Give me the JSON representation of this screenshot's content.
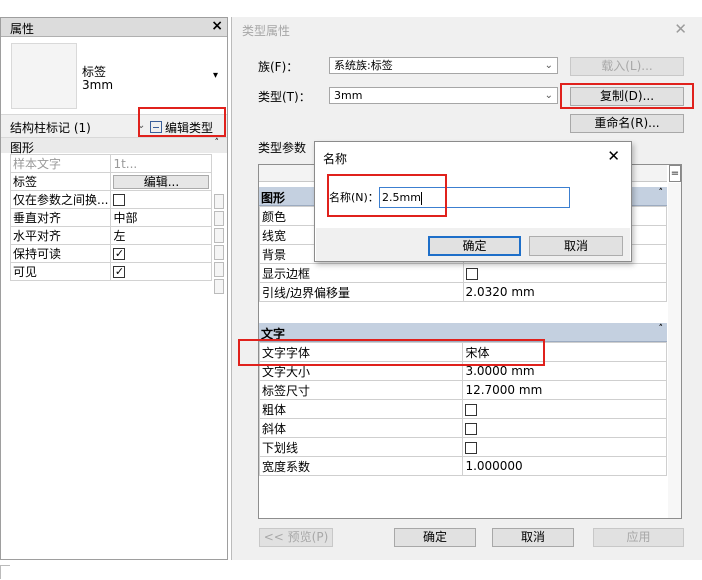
{
  "properties_panel": {
    "title": "属性",
    "close_symbol": "×",
    "type_name_line1": "标签",
    "type_name_line2": "3mm",
    "type_selector_arrow": "▾",
    "instance_filter": "结构柱标记 (1)",
    "instance_filter_chevron": "⌄",
    "edit_type_label": "编辑类型",
    "group_title": "图形",
    "group_collapse": "˄",
    "rows": [
      {
        "key": "样本文字",
        "value": "1t...",
        "greyed": true
      },
      {
        "key": "标签",
        "value_button": "编辑..."
      },
      {
        "key": "仅在参数之间换...",
        "checkbox": false
      },
      {
        "key": "垂直对齐",
        "value": "中部"
      },
      {
        "key": "水平对齐",
        "value": "左"
      },
      {
        "key": "保持可读",
        "checkbox": true
      },
      {
        "key": "可见",
        "checkbox": true
      }
    ]
  },
  "type_properties": {
    "title": "类型属性",
    "close_symbol": "✕",
    "family_label": "族(F)：",
    "family_value": "系统族:标签",
    "type_label": "类型(T)：",
    "type_value": "3mm",
    "load_button": "载入(L)...",
    "duplicate_button": "复制(D)...",
    "rename_button": "重命名(R)...",
    "type_params_label": "类型参数",
    "grid_filter_symbol": "=",
    "sections": [
      {
        "title": "图形",
        "rows": [
          {
            "key": "颜色",
            "value": ""
          },
          {
            "key": "线宽",
            "value": ""
          },
          {
            "key": "背景",
            "value": ""
          },
          {
            "key": "显示边框",
            "checkbox": false
          },
          {
            "key": "引线/边界偏移量",
            "value": "2.0320 mm"
          }
        ]
      },
      {
        "title": "文字",
        "rows": [
          {
            "key": "文字字体",
            "value": "宋体"
          },
          {
            "key": "文字大小",
            "value": "3.0000 mm"
          },
          {
            "key": "标签尺寸",
            "value": "12.7000 mm"
          },
          {
            "key": "粗体",
            "checkbox": false
          },
          {
            "key": "斜体",
            "checkbox": false
          },
          {
            "key": "下划线",
            "checkbox": false
          },
          {
            "key": "宽度系数",
            "value": "1.000000"
          }
        ]
      }
    ],
    "collapse_symbol": "˄",
    "preview_button": "<< 预览(P)",
    "ok_button": "确定",
    "cancel_button": "取消",
    "apply_button": "应用"
  },
  "name_dialog": {
    "title": "名称",
    "close_symbol": "✕",
    "label": "名称(N)：",
    "input_value": "2.5mm",
    "ok_button": "确定",
    "cancel_button": "取消"
  },
  "dropdown_arrow": "⌄",
  "colors": {
    "highlight_red": "#e0211c",
    "section_header": "#c4d0e0",
    "focus_blue": "#1e6fc9"
  }
}
